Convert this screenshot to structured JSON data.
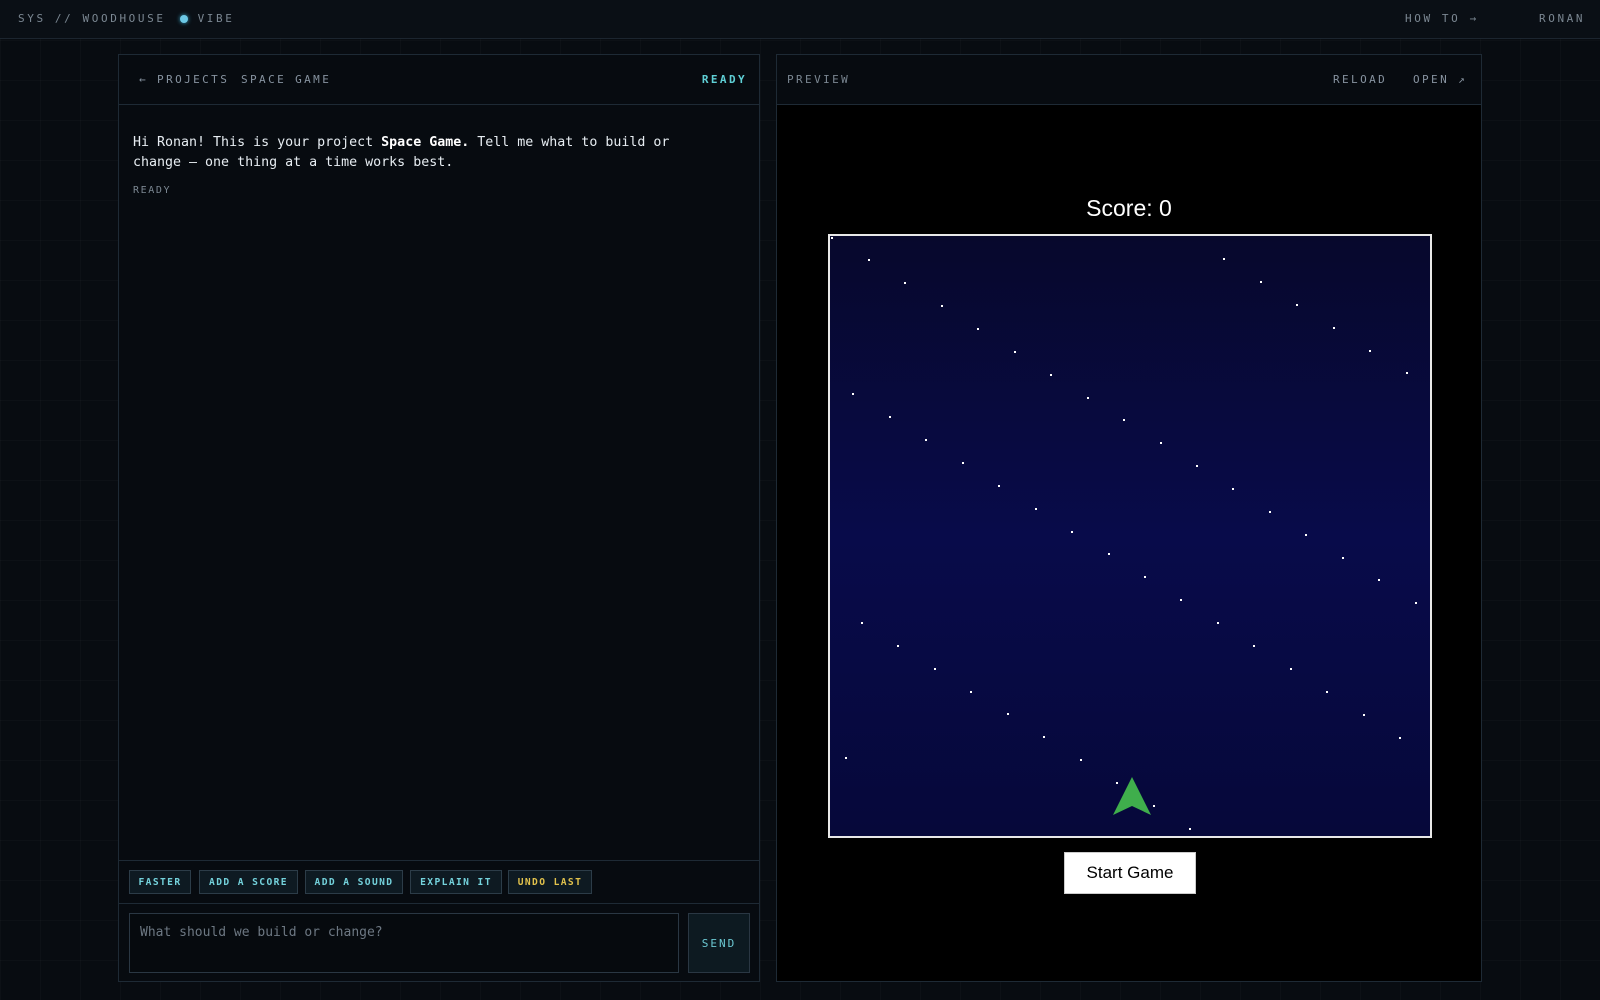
{
  "topbar": {
    "brand_left": "SYS // WOODHOUSE",
    "brand_mode": "VIBE",
    "how_to": "HOW TO →",
    "user": "RONAN"
  },
  "chat_panel": {
    "back_label": "← PROJECTS",
    "project_name": "SPACE GAME",
    "status": "READY",
    "message": {
      "greeting": "Hi Ronan! This is your project ",
      "project": "Space Game.",
      "rest": " Tell me what to build or change — one thing at a time works best."
    },
    "message_status": "READY",
    "chips": [
      {
        "label": "FASTER"
      },
      {
        "label": "ADD A SCORE"
      },
      {
        "label": "ADD A SOUND"
      },
      {
        "label": "EXPLAIN IT"
      },
      {
        "label": "UNDO LAST"
      }
    ],
    "input_placeholder": "What should we build or change?",
    "send_label": "SEND"
  },
  "preview_panel": {
    "label": "PREVIEW",
    "reload_label": "RELOAD",
    "open_label": "OPEN ↗",
    "game": {
      "score_text": "Score: 0",
      "start_label": "Start Game"
    }
  },
  "colors": {
    "accent": "#5fd0d6",
    "warning": "#e2c24c",
    "ship": "#3fae4c",
    "canvas_bg": "#080b4a"
  }
}
